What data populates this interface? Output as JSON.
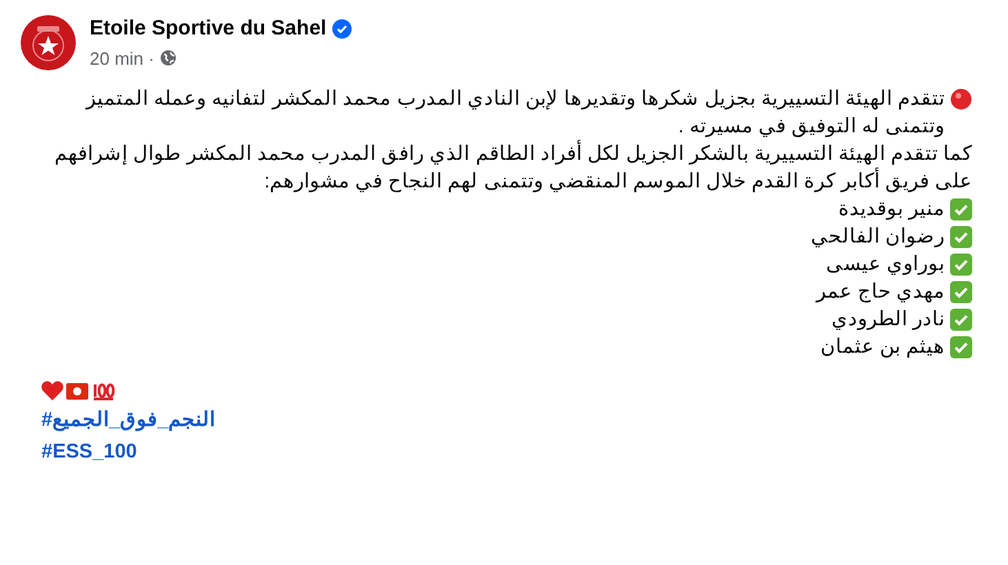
{
  "post": {
    "author": "Etoile Sportive du Sahel",
    "verified": true,
    "time": "20 min ·"
  },
  "paragraphs": [
    "تتقدم الهيئة التسييرية بجزيل شكرها وتقديرها لإبن النادي المدرب محمد المكشر لتفانيه وعمله المتميز  وتتمنى له التوفيق في مسيرته .",
    "كما تتقدم الهيئة التسييرية بالشكر الجزيل لكل أفراد الطاقم الذي رافق المدرب محمد المكشر طوال إشرافهم  على فريق أكابر كرة القدم خلال الموسم المنقضي وتتمنى لهم النجاح في مشوارهم:"
  ],
  "staff": [
    {
      "name": "منير بوقديدة",
      "checked": true
    },
    {
      "name": "رضوان الفالحي",
      "checked": true
    },
    {
      "name": "بوراوي عيسى",
      "checked": true
    },
    {
      "name": "مهدي حاج عمر",
      "checked": true
    },
    {
      "name": "نادر الطرودي",
      "checked": true
    },
    {
      "name": "هيثم بن عثمان",
      "checked": true
    }
  ],
  "hashtags": [
    "#النجم_فوق_الجميع",
    "#ESS_100"
  ]
}
